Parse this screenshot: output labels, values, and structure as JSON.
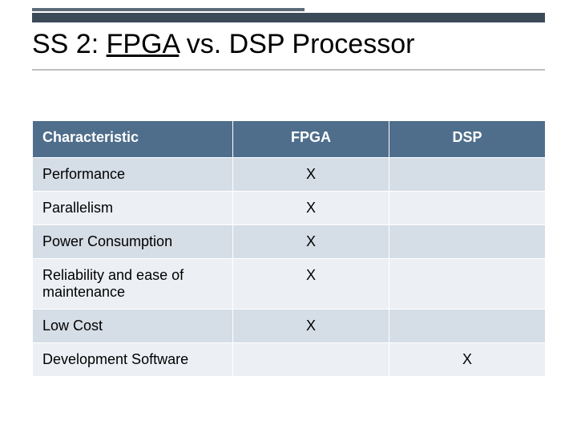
{
  "title": {
    "prefix": "SS 2: ",
    "underlined": "FPGA",
    "suffix": " vs. DSP Processor"
  },
  "table": {
    "headers": [
      "Characteristic",
      "FPGA",
      "DSP"
    ],
    "rows": [
      {
        "label": "Performance",
        "fpga": "X",
        "dsp": ""
      },
      {
        "label": "Parallelism",
        "fpga": "X",
        "dsp": ""
      },
      {
        "label": "Power Consumption",
        "fpga": "X",
        "dsp": ""
      },
      {
        "label": "Reliability and ease of maintenance",
        "fpga": "X",
        "dsp": ""
      },
      {
        "label": "Low Cost",
        "fpga": "X",
        "dsp": ""
      },
      {
        "label": "Development Software",
        "fpga": "",
        "dsp": "X"
      }
    ]
  },
  "chart_data": {
    "type": "table",
    "title": "SS 2: FPGA vs. DSP Processor",
    "columns": [
      "Characteristic",
      "FPGA",
      "DSP"
    ],
    "rows": [
      [
        "Performance",
        "X",
        ""
      ],
      [
        "Parallelism",
        "X",
        ""
      ],
      [
        "Power Consumption",
        "X",
        ""
      ],
      [
        "Reliability and ease of maintenance",
        "X",
        ""
      ],
      [
        "Low Cost",
        "X",
        ""
      ],
      [
        "Development Software",
        "",
        "X"
      ]
    ]
  }
}
